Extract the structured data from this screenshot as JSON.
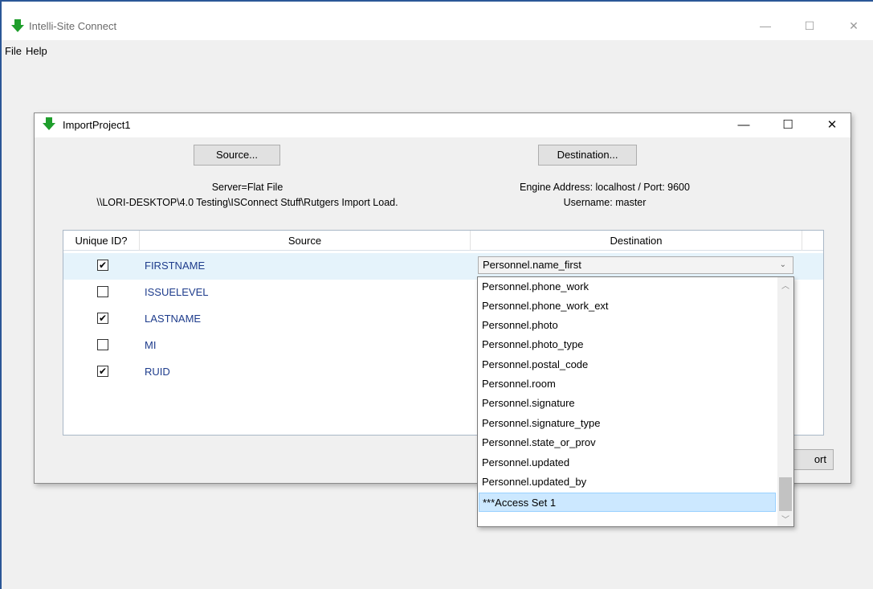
{
  "app": {
    "title": "Intelli-Site Connect",
    "menu": [
      "File",
      "Help"
    ],
    "window_controls": {
      "minimize": "—",
      "maximize": "☐",
      "close": "✕"
    }
  },
  "dialog": {
    "title": "ImportProject1",
    "controls": {
      "minimize": "—",
      "maximize": "☐",
      "close": "✕"
    },
    "source_button": "Source...",
    "destination_button": "Destination...",
    "source_info": {
      "line1": "Server=Flat File",
      "line2": "\\\\LORI-DESKTOP\\4.0 Testing\\ISConnect Stuff\\Rutgers Import Load."
    },
    "destination_info": {
      "line1": "Engine Address: localhost / Port: 9600",
      "line2": "Username: master"
    },
    "grid": {
      "columns": [
        "Unique ID?",
        "Source",
        "Destination"
      ],
      "rows": [
        {
          "unique": true,
          "checkmark": "✔",
          "source": "FIRSTNAME",
          "destination": "Personnel.name_first"
        },
        {
          "unique": false,
          "checkmark": "",
          "source": "ISSUELEVEL",
          "destination": ""
        },
        {
          "unique": true,
          "checkmark": "✔",
          "source": "LASTNAME",
          "destination": ""
        },
        {
          "unique": false,
          "checkmark": "",
          "source": "MI",
          "destination": ""
        },
        {
          "unique": true,
          "checkmark": "✔",
          "source": "RUID",
          "destination": ""
        }
      ]
    },
    "import_button": "ort"
  },
  "dropdown": {
    "selected": "***Access Set 1",
    "items": [
      "Personnel.phone_work",
      "Personnel.phone_work_ext",
      "Personnel.photo",
      "Personnel.photo_type",
      "Personnel.postal_code",
      "Personnel.room",
      "Personnel.signature",
      "Personnel.signature_type",
      "Personnel.state_or_prov",
      "Personnel.updated",
      "Personnel.updated_by",
      "***Access Set 1"
    ]
  },
  "colors": {
    "accent_blue": "#2b5797",
    "source_text": "#1e3c8c",
    "row_highlight": "#e5f3fb",
    "item_highlight": "#cce8ff",
    "icon_green": "#1f9e2c"
  },
  "icons": {
    "app_icon": "green-down-arrow-icon",
    "chevron": "chevron-down-icon"
  }
}
